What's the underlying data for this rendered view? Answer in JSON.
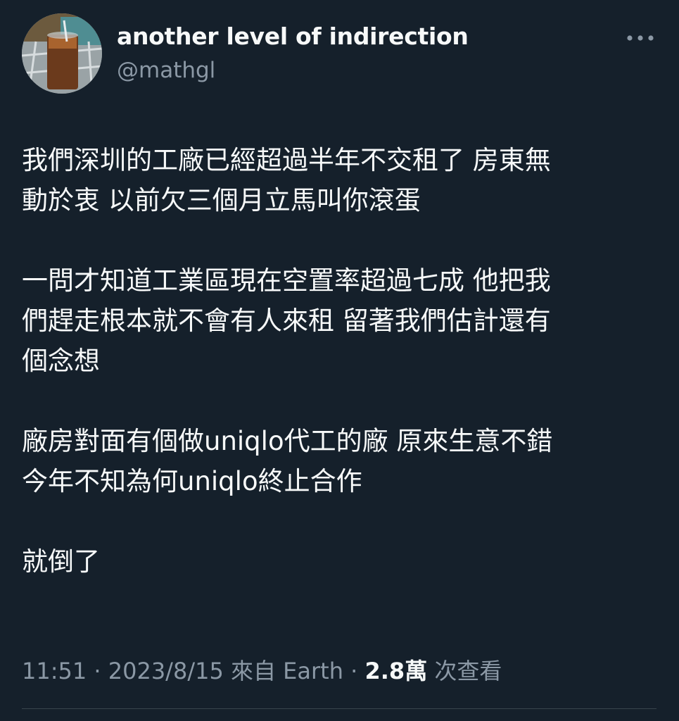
{
  "author": {
    "display_name": "another level of indirection",
    "handle": "@mathgl",
    "avatar_icon": "avatar-iced-tea-photo"
  },
  "more_icon": "ellipsis-horizontal-icon",
  "tweet": {
    "paragraphs": [
      [
        "我們深圳的工廠已經超過半年不交租了 房東無",
        "動於衷 以前欠三個月立馬叫你滾蛋"
      ],
      [
        "一問才知道工業區現在空置率超過七成 他把我",
        "們趕走根本就不會有人來租 留著我們估計還有",
        "個念想"
      ],
      [
        "廠房對面有個做uniqlo代工的廠 原來生意不錯",
        "今年不知為何uniqlo終止合作"
      ],
      [
        "就倒了"
      ]
    ]
  },
  "meta": {
    "time": "11:51",
    "sep1": " · ",
    "date": "2023/8/15",
    "source": " 來自 Earth",
    "sep2": " · ",
    "view_count": "2.8萬",
    "view_label": " 次查看"
  },
  "colors": {
    "background": "#15202b",
    "text_primary": "#f7f9f9",
    "text_secondary": "#8b98a5",
    "divider": "#38444d"
  }
}
